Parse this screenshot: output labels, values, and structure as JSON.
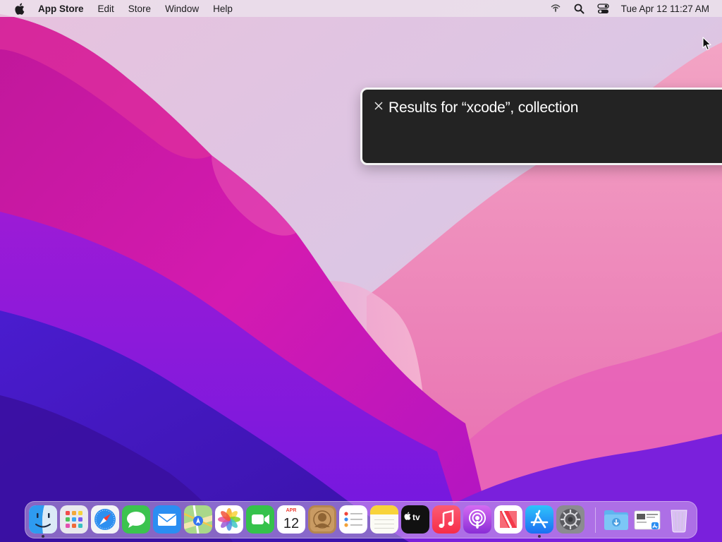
{
  "menubar": {
    "app_name": "App Store",
    "menus": [
      "Edit",
      "Store",
      "Window",
      "Help"
    ],
    "clock": "Tue Apr 12  11:27 AM"
  },
  "caption_panel": {
    "text": "Results for “xcode”, collection"
  },
  "dock": {
    "apps": [
      {
        "name": "Finder",
        "running": true
      },
      {
        "name": "Launchpad",
        "running": false
      },
      {
        "name": "Safari",
        "running": false
      },
      {
        "name": "Messages",
        "running": false
      },
      {
        "name": "Mail",
        "running": false
      },
      {
        "name": "Maps",
        "running": false
      },
      {
        "name": "Photos",
        "running": false
      },
      {
        "name": "FaceTime",
        "running": false
      },
      {
        "name": "Calendar",
        "running": false
      },
      {
        "name": "Contacts",
        "running": false
      },
      {
        "name": "Reminders",
        "running": false
      },
      {
        "name": "Notes",
        "running": false
      },
      {
        "name": "TV",
        "running": false
      },
      {
        "name": "Music",
        "running": false
      },
      {
        "name": "Podcasts",
        "running": false
      },
      {
        "name": "News",
        "running": false
      },
      {
        "name": "App Store",
        "running": true
      },
      {
        "name": "System Preferences",
        "running": false
      }
    ],
    "calendar_month": "APR",
    "calendar_day": "12",
    "tv_label": "tv",
    "extras": [
      "Downloads",
      "Recent Item",
      "Trash"
    ]
  },
  "colors": {
    "caption_bg": "#232323",
    "caption_border": "#f4f4f4",
    "menubar_bg": "#ece2ec"
  }
}
